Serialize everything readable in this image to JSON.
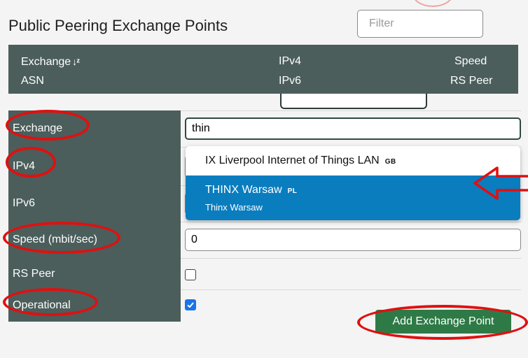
{
  "header": {
    "title": "Public Peering Exchange Points",
    "filter_placeholder": "Filter"
  },
  "table_header": {
    "col1_line1": "Exchange",
    "col1_line2": "ASN",
    "col2_line1": "IPv4",
    "col2_line2": "IPv6",
    "col3_line1": "Speed",
    "col3_line2": "RS Peer"
  },
  "form": {
    "exchange": {
      "label": "Exchange",
      "value": "thin"
    },
    "ipv4": {
      "label": "IPv4",
      "value": ""
    },
    "ipv6": {
      "label": "IPv6",
      "value": ""
    },
    "speed": {
      "label": "Speed (mbit/sec)",
      "value": "0"
    },
    "rs_peer": {
      "label": "RS Peer",
      "checked": false
    },
    "operational": {
      "label": "Operational",
      "checked": true
    }
  },
  "dropdown": {
    "options": [
      {
        "name": "IX Liverpool Internet of Things LAN",
        "country": "GB",
        "subtitle": "",
        "selected": false
      },
      {
        "name": "THINX Warsaw",
        "country": "PL",
        "subtitle": "Thinx Warsaw",
        "selected": true
      }
    ]
  },
  "actions": {
    "add_label": "Add Exchange Point"
  },
  "colors": {
    "header_bg": "#4b5e5b",
    "selected_option": "#0a7dbf",
    "add_button": "#2e7a47",
    "annotation": "#e01010"
  },
  "icons": {
    "sort": "sort-az-icon",
    "annotation_arrow": "arrow-left-icon"
  }
}
